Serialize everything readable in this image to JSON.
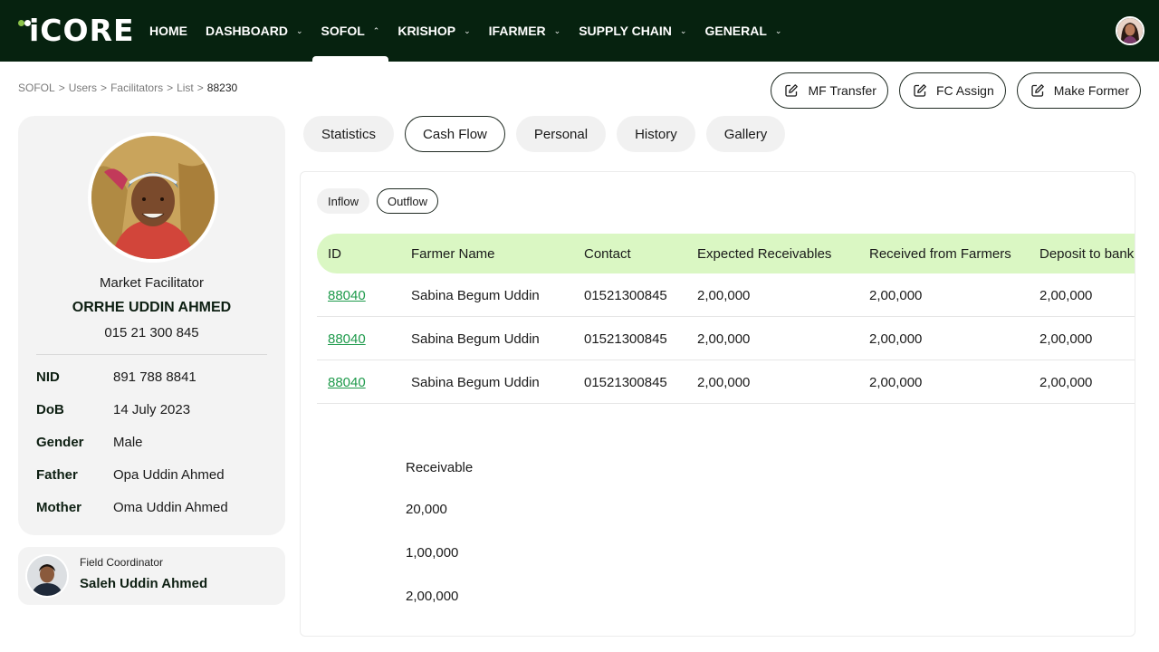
{
  "nav": {
    "logo_text": "iCORE",
    "items": [
      {
        "label": "HOME",
        "has_dropdown": false,
        "active": false
      },
      {
        "label": "DASHBOARD",
        "has_dropdown": true,
        "active": false
      },
      {
        "label": "SOFOL",
        "has_dropdown": true,
        "active": true
      },
      {
        "label": "KRISHOP",
        "has_dropdown": true,
        "active": false
      },
      {
        "label": "IFARMER",
        "has_dropdown": true,
        "active": false
      },
      {
        "label": "SUPPLY CHAIN",
        "has_dropdown": true,
        "active": false
      },
      {
        "label": "GENERAL",
        "has_dropdown": true,
        "active": false
      }
    ]
  },
  "breadcrumb": {
    "items": [
      "SOFOL",
      "Users",
      "Facilitators",
      "List"
    ],
    "separator": ">",
    "current": "88230"
  },
  "actions": {
    "mf_transfer": "MF Transfer",
    "fc_assign": "FC Assign",
    "make_former": "Make Former"
  },
  "profile": {
    "role": "Market Facilitator",
    "name": "ORRHE UDDIN AHMED",
    "phone": "015 21 300 845",
    "fields": {
      "nid": {
        "label": "NID",
        "value": "891 788 8841"
      },
      "dob": {
        "label": "DoB",
        "value": "14 July 2023"
      },
      "gender": {
        "label": "Gender",
        "value": "Male"
      },
      "father": {
        "label": "Father",
        "value": "Opa Uddin Ahmed"
      },
      "mother": {
        "label": "Mother",
        "value": "Oma Uddin Ahmed"
      }
    }
  },
  "coordinator": {
    "role": "Field Coordinator",
    "name": "Saleh Uddin Ahmed"
  },
  "tabs": {
    "items": [
      "Statistics",
      "Cash Flow",
      "Personal",
      "History",
      "Gallery"
    ],
    "active": "Cash Flow"
  },
  "subtabs": {
    "items": [
      "Inflow",
      "Outflow"
    ],
    "active": "Outflow"
  },
  "table": {
    "columns": [
      "ID",
      "Farmer Name",
      "Contact",
      "Expected Receivables",
      "Received from Farmers",
      "Deposit to bank"
    ],
    "rows": [
      [
        "88040",
        "Sabina Begum Uddin",
        "01521300845",
        "2,00,000",
        "2,00,000",
        "2,00,000"
      ],
      [
        "88040",
        "Sabina Begum Uddin",
        "01521300845",
        "2,00,000",
        "2,00,000",
        "2,00,000"
      ],
      [
        "88040",
        "Sabina Begum Uddin",
        "01521300845",
        "2,00,000",
        "2,00,000",
        "2,00,000"
      ]
    ]
  },
  "receivable": {
    "label": "Receivable",
    "values": [
      "20,000",
      "1,00,000",
      "2,00,000"
    ]
  },
  "colors": {
    "nav_bg": "#06220f",
    "table_header_bg": "#daf7c3",
    "link": "#1e9a4b",
    "card_bg": "#f3f3f3"
  }
}
